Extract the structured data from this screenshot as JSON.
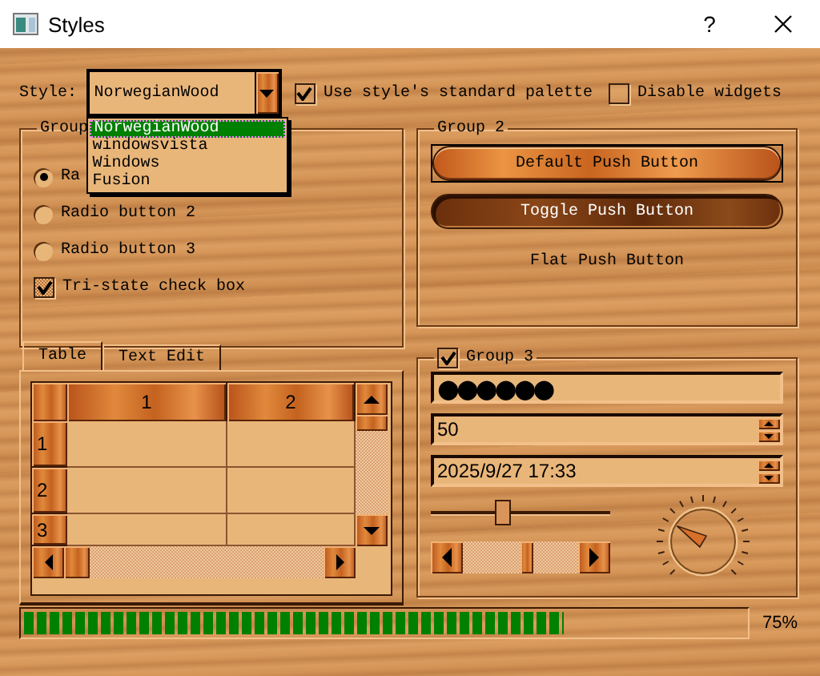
{
  "window": {
    "title": "Styles",
    "help": "?"
  },
  "style_row": {
    "label": "Style:",
    "combo": {
      "value": "NorwegianWood",
      "expanded": true,
      "options": [
        {
          "label": "NorwegianWood",
          "selected": true
        },
        {
          "label": "windowsvista",
          "selected": false
        },
        {
          "label": "Windows",
          "selected": false
        },
        {
          "label": "Fusion",
          "selected": false
        }
      ]
    },
    "palette_checkbox": {
      "label": "Use style's standard palette",
      "checked": true
    },
    "disable_checkbox": {
      "label": "Disable widgets",
      "checked": false
    }
  },
  "group1": {
    "title": "Group",
    "radios": [
      {
        "label": "Ra",
        "selected": true
      },
      {
        "label": "Radio button 2",
        "selected": false
      },
      {
        "label": "Radio button 3",
        "selected": false
      }
    ],
    "tristate": {
      "label": "Tri-state check box",
      "checked": true
    }
  },
  "group2": {
    "title": "Group 2",
    "buttons": [
      {
        "label": "Default Push Button",
        "kind": "default"
      },
      {
        "label": "Toggle Push Button",
        "kind": "toggle",
        "on": true
      },
      {
        "label": "Flat Push Button",
        "kind": "flat"
      }
    ]
  },
  "tabs": [
    {
      "label": "Table",
      "selected": true
    },
    {
      "label": "Text Edit",
      "selected": false
    }
  ],
  "table": {
    "columns": [
      "1",
      "2"
    ],
    "rows": [
      "1",
      "2",
      "3"
    ]
  },
  "group3": {
    "title": "Group 3",
    "checked": true,
    "password": "●●●●●●",
    "spinbox": "50",
    "datetime": "2025/9/27 17:33",
    "slider": {
      "level": 0.4
    },
    "dial": {
      "level": 0.28
    }
  },
  "progress": {
    "level": 0.75,
    "text": "75%"
  }
}
